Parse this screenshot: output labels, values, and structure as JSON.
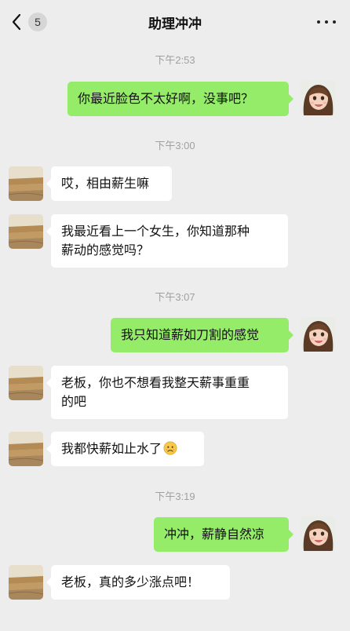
{
  "header": {
    "back_badge": "5",
    "title": "助理冲冲"
  },
  "timestamps": [
    "下午2:53",
    "下午3:00",
    "下午3:07",
    "下午3:19"
  ],
  "messages": [
    {
      "side": "out",
      "text": "你最近脸色不太好啊，没事吧？"
    },
    {
      "side": "in",
      "text": "哎，相由薪生嘛"
    },
    {
      "side": "in",
      "line1": "我最近看上一个女生，你知道那种",
      "line2": "薪动的感觉吗？"
    },
    {
      "side": "out",
      "text": "我只知道薪如刀割的感觉"
    },
    {
      "side": "in",
      "line1": "老板，你也不想看我整天薪事重重",
      "line2": "的吧"
    },
    {
      "side": "in",
      "text": "我都快薪如止水了",
      "emoji": "sad-face-emoji"
    },
    {
      "side": "out",
      "text": "冲冲，薪静自然凉"
    },
    {
      "side": "in",
      "text": "老板，真的多少涨点吧！"
    }
  ],
  "colors": {
    "background": "#ededed",
    "outgoing_bubble": "#95ec69",
    "incoming_bubble": "#ffffff",
    "timestamp": "#a0a0a0"
  },
  "icons": [
    "chevron-left-icon",
    "more-dots-icon",
    "girl-avatar",
    "desert-avatar",
    "sad-face-emoji"
  ]
}
